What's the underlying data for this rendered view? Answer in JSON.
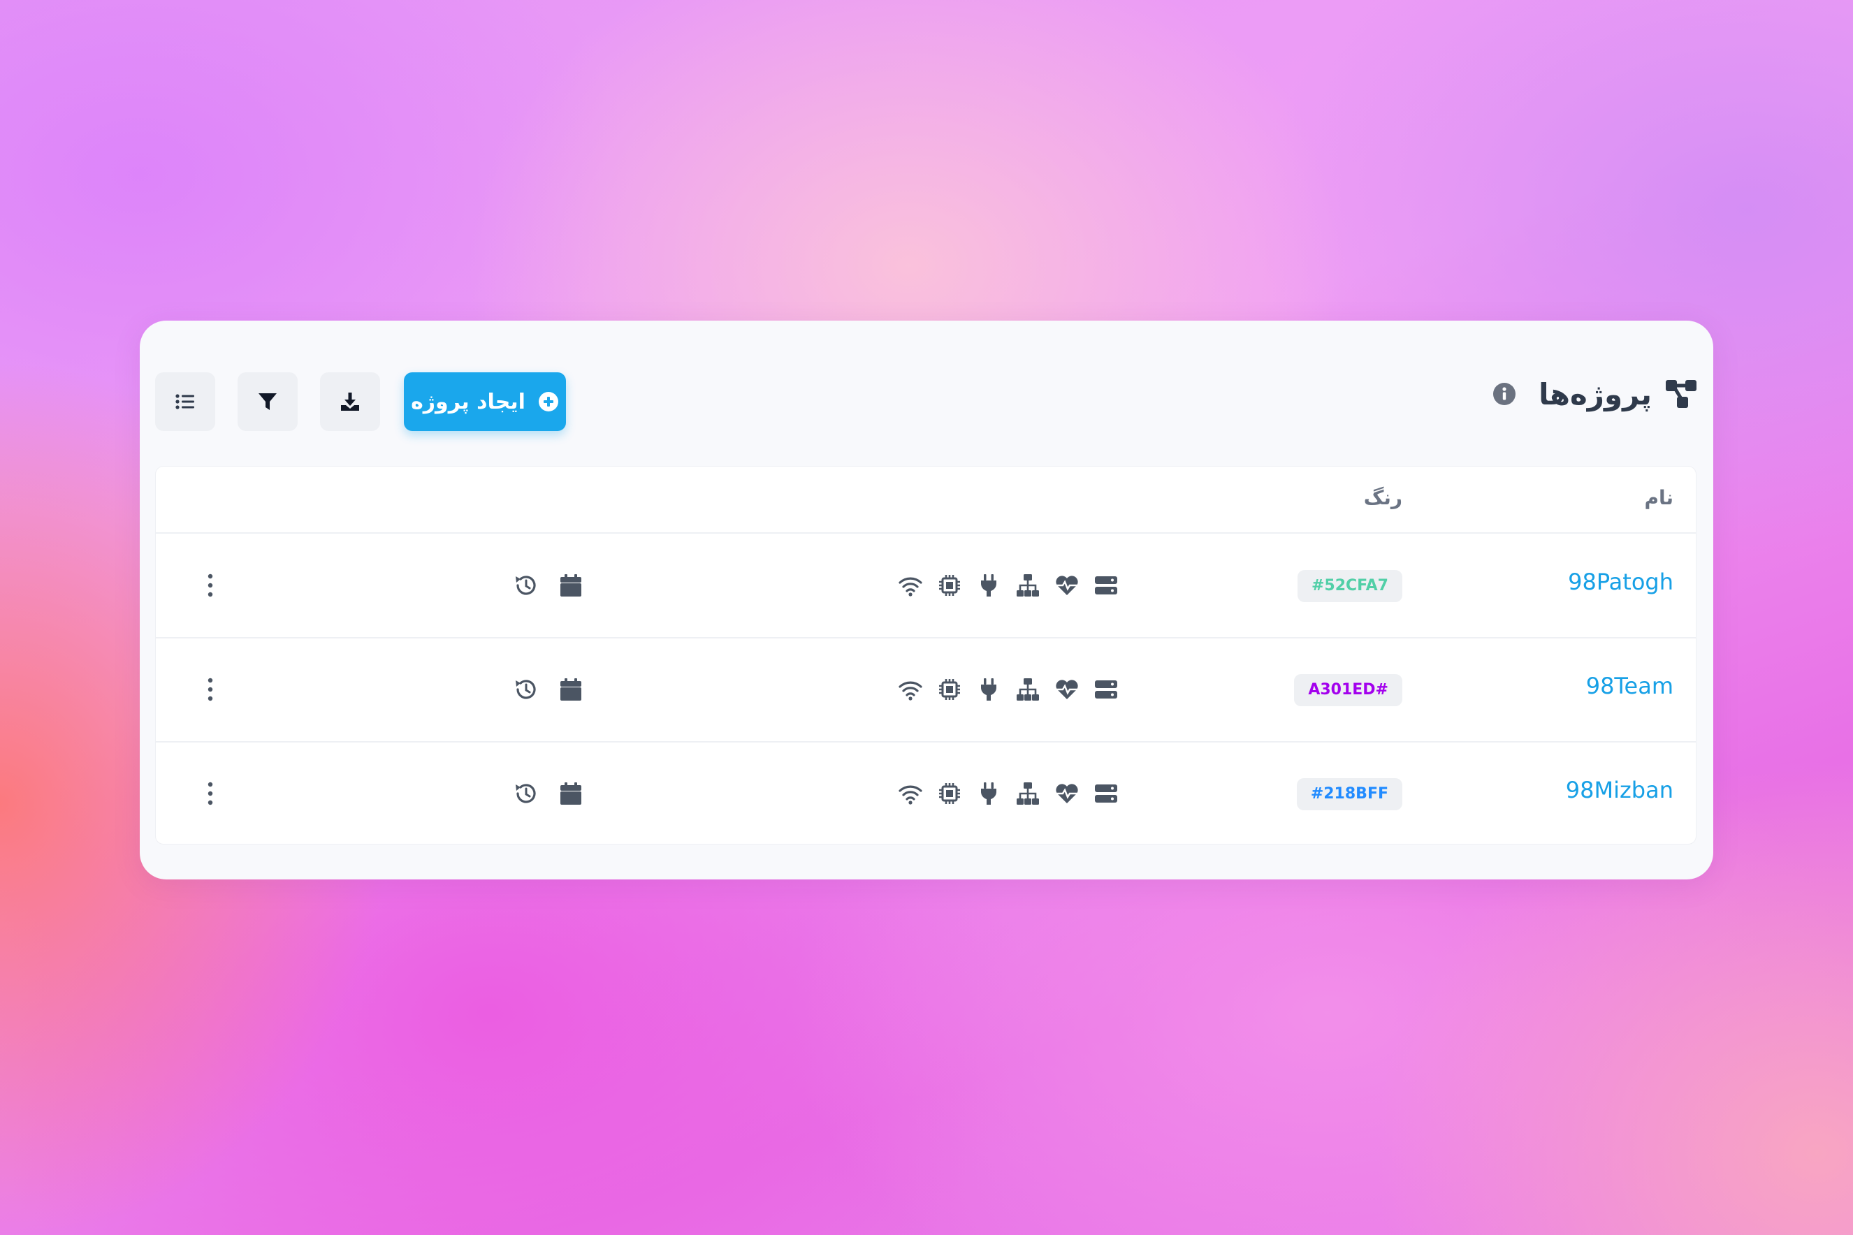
{
  "header": {
    "title": "پروژه‌ها",
    "create_button_label": "ایجاد پروژه"
  },
  "icons": {
    "title": "project-icon",
    "info": "info-icon",
    "create": "plus-circle-icon",
    "download": "download-icon",
    "filter": "filter-icon",
    "list": "list-icon",
    "status": [
      "wifi-icon",
      "chip-icon",
      "plug-icon",
      "network-icon",
      "heartbeat-icon",
      "server-icon"
    ],
    "time": [
      "history-icon",
      "calendar-icon"
    ],
    "row_menu": "more-vertical-icon"
  },
  "colors": {
    "accent": "#1aa7ec",
    "link": "#17a0e6",
    "icon": "#4b5563"
  },
  "table": {
    "headers": {
      "name": "نام",
      "color": "رنگ"
    },
    "rows": [
      {
        "name": "98Patogh",
        "color_label": "#52CFA7",
        "color_hex": "#52CFA7"
      },
      {
        "name": "98Team",
        "color_label": "A301ED#",
        "color_hex": "#A301ED"
      },
      {
        "name": "98Mizban",
        "color_label": "#218BFF",
        "color_hex": "#218BFF"
      }
    ]
  }
}
